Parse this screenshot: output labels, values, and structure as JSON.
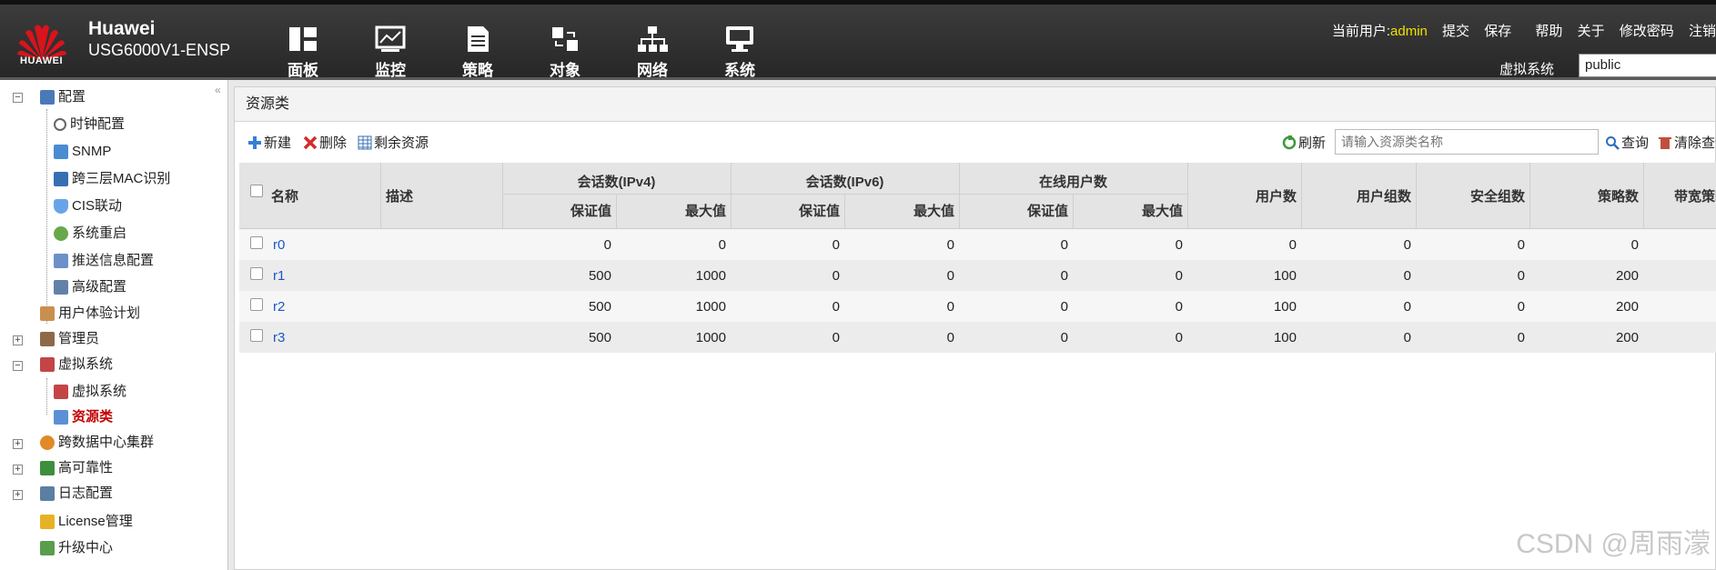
{
  "header": {
    "brand_name": "Huawei",
    "device_model": "USG6000V1-ENSP",
    "logo_text": "HUAWEI",
    "nav": [
      {
        "label": "面板",
        "icon": "dashboard-icon"
      },
      {
        "label": "监控",
        "icon": "monitor-chart-icon"
      },
      {
        "label": "策略",
        "icon": "policy-doc-icon"
      },
      {
        "label": "对象",
        "icon": "object-icon"
      },
      {
        "label": "网络",
        "icon": "network-icon"
      },
      {
        "label": "系统",
        "icon": "system-monitor-icon"
      }
    ],
    "current_user_label": "当前用户:",
    "current_user": "admin",
    "links": [
      "提交",
      "保存",
      "帮助",
      "关于",
      "修改密码",
      "注销"
    ],
    "vsys_label": "虚拟系统",
    "vsys_value": "public"
  },
  "sidebar": {
    "items": [
      {
        "label": "配置",
        "icon": "config-icon"
      },
      {
        "label": "时钟配置",
        "icon": "clock-icon"
      },
      {
        "label": "SNMP",
        "icon": "snmp-icon"
      },
      {
        "label": "跨三层MAC识别",
        "icon": "mac-icon"
      },
      {
        "label": "CIS联动",
        "icon": "shield-icon"
      },
      {
        "label": "系统重启",
        "icon": "reboot-icon"
      },
      {
        "label": "推送信息配置",
        "icon": "push-message-icon"
      },
      {
        "label": "高级配置",
        "icon": "advanced-config-icon"
      },
      {
        "label": "用户体验计划",
        "icon": "user-experience-icon"
      },
      {
        "label": "管理员",
        "icon": "admin-icon"
      },
      {
        "label": "虚拟系统",
        "icon": "vsys-icon"
      },
      {
        "label": "虚拟系统",
        "icon": "vsys-icon"
      },
      {
        "label": "资源类",
        "icon": "resource-class-icon"
      },
      {
        "label": "跨数据中心集群",
        "icon": "datacenter-cluster-icon"
      },
      {
        "label": "高可靠性",
        "icon": "high-availability-icon"
      },
      {
        "label": "日志配置",
        "icon": "log-config-icon"
      },
      {
        "label": "License管理",
        "icon": "license-icon"
      },
      {
        "label": "升级中心",
        "icon": "upgrade-icon"
      }
    ]
  },
  "main": {
    "title": "资源类",
    "toolbar": {
      "new": "新建",
      "delete": "删除",
      "remaining": "剩余资源",
      "refresh": "刷新",
      "search_placeholder": "请输入资源类名称",
      "query": "查询",
      "clear": "清除查询"
    },
    "table": {
      "headers": {
        "name": "名称",
        "desc": "描述",
        "session_ipv4": "会话数(IPv4)",
        "session_ipv6": "会话数(IPv6)",
        "online_users": "在线用户数",
        "guaranteed": "保证值",
        "max": "最大值",
        "users": "用户数",
        "user_groups": "用户组数",
        "security_groups": "安全组数",
        "policies": "策略数",
        "bandwidth": "带宽策略数"
      },
      "rows": [
        {
          "name": "r0",
          "desc": "",
          "v4g": "0",
          "v4m": "0",
          "v6g": "0",
          "v6m": "0",
          "oug": "0",
          "oum": "0",
          "users": "0",
          "ugroups": "0",
          "sgroups": "0",
          "policies": "0"
        },
        {
          "name": "r1",
          "desc": "",
          "v4g": "500",
          "v4m": "1000",
          "v6g": "0",
          "v6m": "0",
          "oug": "0",
          "oum": "0",
          "users": "100",
          "ugroups": "0",
          "sgroups": "0",
          "policies": "200"
        },
        {
          "name": "r2",
          "desc": "",
          "v4g": "500",
          "v4m": "1000",
          "v6g": "0",
          "v6m": "0",
          "oug": "0",
          "oum": "0",
          "users": "100",
          "ugroups": "0",
          "sgroups": "0",
          "policies": "200"
        },
        {
          "name": "r3",
          "desc": "",
          "v4g": "500",
          "v4m": "1000",
          "v6g": "0",
          "v6m": "0",
          "oug": "0",
          "oum": "0",
          "users": "100",
          "ugroups": "0",
          "sgroups": "0",
          "policies": "200"
        }
      ]
    }
  },
  "watermark": "CSDN @周雨濛",
  "colors": {
    "header_bg": "#2e2e2e",
    "user_highlight": "#f0e000",
    "link": "#1a57c9",
    "selected": "#c40000"
  }
}
